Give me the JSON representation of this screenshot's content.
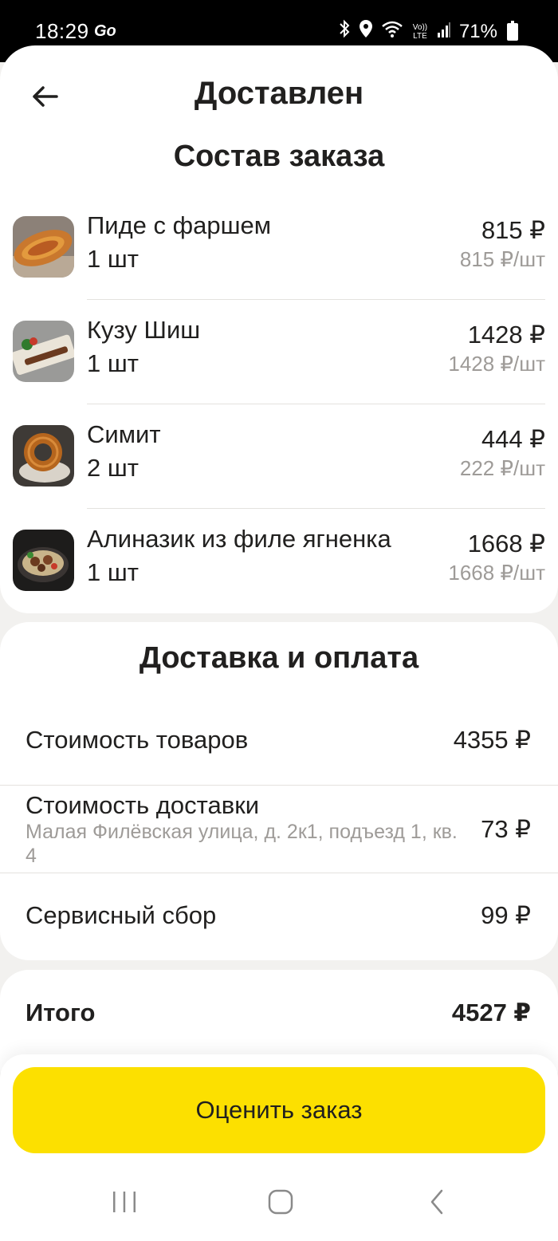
{
  "status_bar": {
    "time": "18:29",
    "go_label": "Go",
    "battery": "71%",
    "volte": "Vo)) LTE"
  },
  "header": {
    "title": "Доставлен"
  },
  "order": {
    "title": "Состав заказа",
    "items": [
      {
        "name": "Пиде с фаршем",
        "qty": "1 шт",
        "price": "815 ₽",
        "unit_price": "815 ₽/шт"
      },
      {
        "name": "Кузу Шиш",
        "qty": "1 шт",
        "price": "1428 ₽",
        "unit_price": "1428 ₽/шт"
      },
      {
        "name": "Симит",
        "qty": "2 шт",
        "price": "444 ₽",
        "unit_price": "222 ₽/шт"
      },
      {
        "name": "Алиназик из филе ягненка",
        "qty": "1 шт",
        "price": "1668 ₽",
        "unit_price": "1668 ₽/шт"
      }
    ]
  },
  "delivery": {
    "title": "Доставка и оплата",
    "goods_label": "Стоимость товаров",
    "goods_value": "4355 ₽",
    "delivery_label": "Стоимость доставки",
    "delivery_address": "Малая Филёвская улица, д. 2к1, подъезд 1, кв. 4",
    "delivery_value": "73 ₽",
    "service_label": "Сервисный сбор",
    "service_value": "99 ₽"
  },
  "total": {
    "label": "Итого",
    "value": "4527 ₽"
  },
  "actions": {
    "rate_label": "Оценить заказ"
  },
  "colors": {
    "accent": "#fce000",
    "background": "#f2f1ef",
    "muted_text": "#9e9b98"
  }
}
